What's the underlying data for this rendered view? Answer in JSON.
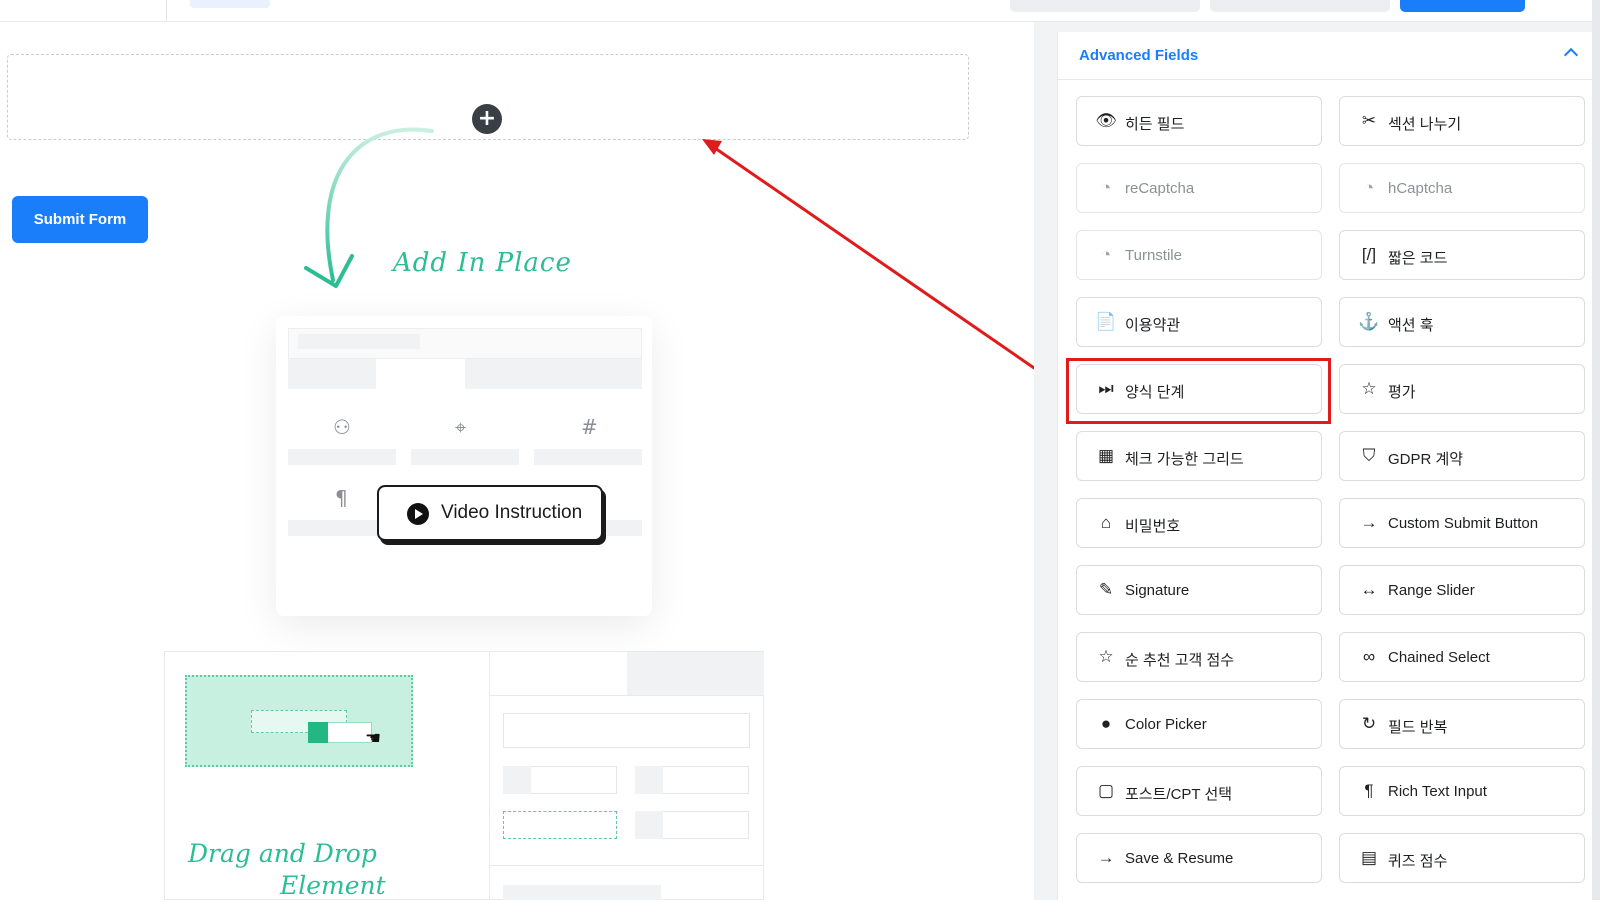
{
  "canvas": {
    "submit_label": "Submit Form",
    "add_in_place": "Add In Place",
    "drag_drop_line1": "Drag and Drop",
    "drag_drop_line2": "Element",
    "video_instruction": "Video Instruction"
  },
  "panel": {
    "title": "Advanced Fields",
    "fields": [
      {
        "label": "히든 필드",
        "icon": "eye-slash-icon",
        "glyph": "👁",
        "disabled": false
      },
      {
        "label": "섹션 나누기",
        "icon": "puzzle-icon",
        "glyph": "✂",
        "disabled": false
      },
      {
        "label": "reCaptcha",
        "icon": "recaptcha-icon",
        "glyph": "◔",
        "disabled": true
      },
      {
        "label": "hCaptcha",
        "icon": "hcaptcha-icon",
        "glyph": "◔",
        "disabled": true
      },
      {
        "label": "Turnstile",
        "icon": "turnstile-icon",
        "glyph": "◔",
        "disabled": true
      },
      {
        "label": "짧은 코드",
        "icon": "shortcode-icon",
        "glyph": "[/]",
        "disabled": false
      },
      {
        "label": "이용약관",
        "icon": "document-icon",
        "glyph": "📄",
        "disabled": false
      },
      {
        "label": "액션 훅",
        "icon": "hook-icon",
        "glyph": "⚓",
        "disabled": false
      },
      {
        "label": "양식 단계",
        "icon": "step-forward-icon",
        "glyph": "⏭",
        "disabled": false
      },
      {
        "label": "평가",
        "icon": "star-icon",
        "glyph": "☆",
        "disabled": false
      },
      {
        "label": "체크 가능한 그리드",
        "icon": "grid-check-icon",
        "glyph": "▦",
        "disabled": false
      },
      {
        "label": "GDPR 계약",
        "icon": "shield-icon",
        "glyph": "⛉",
        "disabled": false
      },
      {
        "label": "비밀번호",
        "icon": "lock-icon",
        "glyph": "⌂",
        "disabled": false
      },
      {
        "label": "Custom Submit Button",
        "icon": "arrow-right-icon",
        "glyph": "→",
        "disabled": false
      },
      {
        "label": "Signature",
        "icon": "pen-icon",
        "glyph": "✎",
        "disabled": false
      },
      {
        "label": "Range Slider",
        "icon": "range-slider-icon",
        "glyph": "↔",
        "disabled": false
      },
      {
        "label": "순 추천 고객 점수",
        "icon": "star-outline-icon",
        "glyph": "☆",
        "disabled": false
      },
      {
        "label": "Chained Select",
        "icon": "link-icon",
        "glyph": "∞",
        "disabled": false
      },
      {
        "label": "Color Picker",
        "icon": "droplet-icon",
        "glyph": "●",
        "disabled": false
      },
      {
        "label": "필드 반복",
        "icon": "repeat-icon",
        "glyph": "↻",
        "disabled": false
      },
      {
        "label": "포스트/CPT 선택",
        "icon": "post-select-icon",
        "glyph": "▢",
        "disabled": false
      },
      {
        "label": "Rich Text Input",
        "icon": "paragraph-icon",
        "glyph": "¶",
        "disabled": false
      },
      {
        "label": "Save & Resume",
        "icon": "arrow-right-icon",
        "glyph": "→",
        "disabled": false
      },
      {
        "label": "퀴즈 점수",
        "icon": "quiz-score-icon",
        "glyph": "▤",
        "disabled": false
      }
    ]
  },
  "colors": {
    "accent": "#1a7efb",
    "highlight": "#e01b1b",
    "handwriting": "#2dbd93"
  }
}
